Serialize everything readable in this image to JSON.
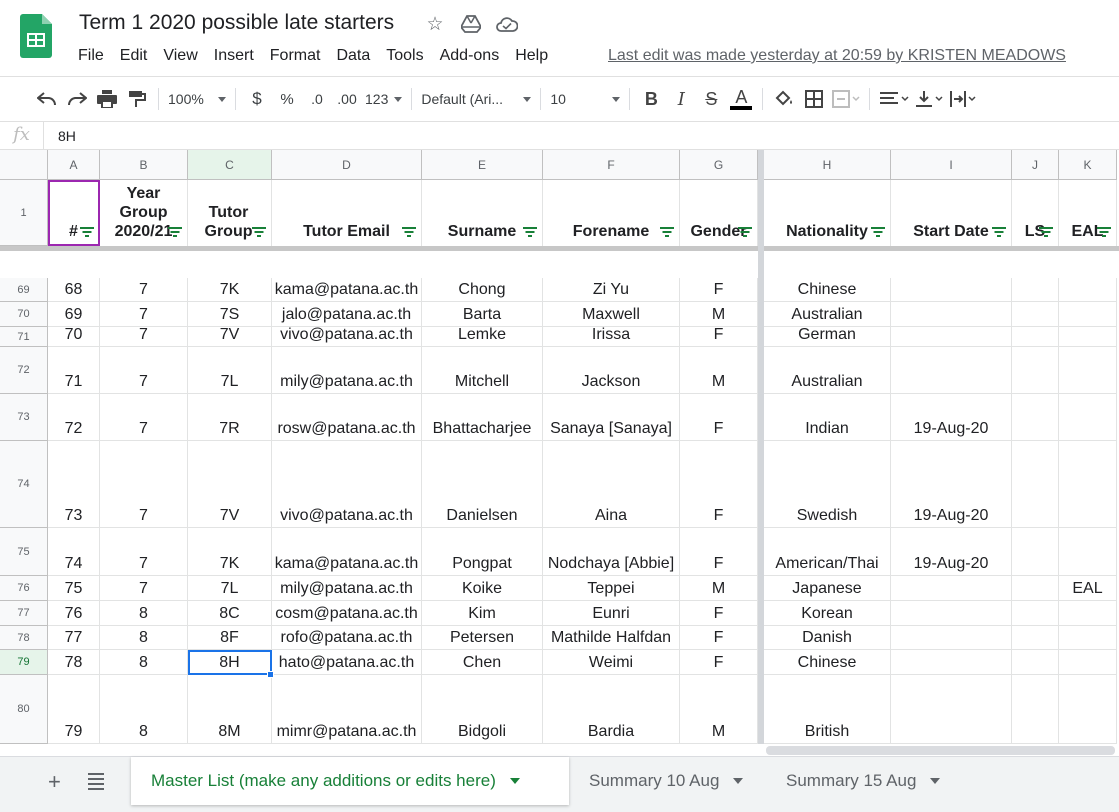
{
  "app": {
    "title": "Term 1 2020 possible late starters",
    "menu": [
      "File",
      "Edit",
      "View",
      "Insert",
      "Format",
      "Data",
      "Tools",
      "Add-ons",
      "Help"
    ],
    "last_edit": "Last edit was made yesterday at 20:59 by KRISTEN MEADOWS"
  },
  "toolbar": {
    "zoom": "100%",
    "currency": "$",
    "percent": "%",
    "decrease_decimal": ".0",
    "increase_decimal": ".00",
    "more_formats": "123",
    "font": "Default (Ari...",
    "font_size": "10",
    "bold": "B",
    "italic": "I",
    "strike": "S",
    "text_color": "A",
    "text_color_hex": "#000000"
  },
  "formula_bar": {
    "fx": "fx",
    "value": "8H"
  },
  "grid": {
    "columns": [
      "A",
      "B",
      "C",
      "D",
      "E",
      "F",
      "G",
      "H",
      "I",
      "J",
      "K"
    ],
    "header_row_number": "1",
    "headers": [
      "#",
      "Year\nGroup\n2020/21",
      "Tutor Group",
      "Tutor Email",
      "Surname",
      "Forename",
      "Gender",
      "Nationality",
      "Start Date",
      "LS",
      "EAL"
    ],
    "rows": [
      {
        "n": "69",
        "cells": [
          "68",
          "7",
          "7K",
          "kama@patana.ac.th",
          "Chong",
          "Zi Yu",
          "F",
          "Chinese",
          "",
          "",
          ""
        ]
      },
      {
        "n": "70",
        "cells": [
          "69",
          "7",
          "7S",
          "jalo@patana.ac.th",
          "Barta",
          "Maxwell",
          "M",
          "Australian",
          "",
          "",
          ""
        ]
      },
      {
        "n": "71",
        "cells": [
          "70",
          "7",
          "7V",
          "vivo@patana.ac.th",
          "Lemke",
          "Irissa",
          "F",
          "German",
          "",
          "",
          ""
        ]
      },
      {
        "n": "72",
        "cells": [
          "71",
          "7",
          "7L",
          "mily@patana.ac.th",
          "Mitchell",
          "Jackson",
          "M",
          "Australian",
          "",
          "",
          ""
        ]
      },
      {
        "n": "73",
        "cells": [
          "72",
          "7",
          "7R",
          "rosw@patana.ac.th",
          "Bhattacharjee",
          "Sanaya [Sanaya]",
          "F",
          "Indian",
          "19-Aug-20",
          "",
          ""
        ]
      },
      {
        "n": "74",
        "cells": [
          "73",
          "7",
          "7V",
          "vivo@patana.ac.th",
          "Danielsen",
          "Aina",
          "F",
          "Swedish",
          "19-Aug-20",
          "",
          ""
        ]
      },
      {
        "n": "75",
        "cells": [
          "74",
          "7",
          "7K",
          "kama@patana.ac.th",
          "Pongpat",
          "Nodchaya [Abbie]",
          "F",
          "American/Thai",
          "19-Aug-20",
          "",
          ""
        ]
      },
      {
        "n": "76",
        "cells": [
          "75",
          "7",
          "7L",
          "mily@patana.ac.th",
          "Koike",
          "Teppei",
          "M",
          "Japanese",
          "",
          "",
          "EAL"
        ]
      },
      {
        "n": "77",
        "cells": [
          "76",
          "8",
          "8C",
          "cosm@patana.ac.th",
          "Kim",
          "Eunri",
          "F",
          "Korean",
          "",
          "",
          ""
        ]
      },
      {
        "n": "78",
        "cells": [
          "77",
          "8",
          "8F",
          "rofo@patana.ac.th",
          "Petersen",
          "Mathilde Halfdan",
          "F",
          "Danish",
          "",
          "",
          ""
        ]
      },
      {
        "n": "79",
        "cells": [
          "78",
          "8",
          "8H",
          "hato@patana.ac.th",
          "Chen",
          "Weimi",
          "F",
          "Chinese",
          "",
          "",
          ""
        ]
      },
      {
        "n": "80",
        "cells": [
          "79",
          "8",
          "8M",
          "mimr@patana.ac.th",
          "Bidgoli",
          "Bardia",
          "M",
          "British",
          "",
          "",
          ""
        ]
      }
    ]
  },
  "sheets": {
    "add": "+",
    "tabs": [
      "Master List (make any additions or edits here)",
      "Summary 10 Aug",
      "Summary 15 Aug"
    ],
    "active_index": 0
  },
  "colors": {
    "accent": "#188038",
    "selection": "#1a73e8"
  }
}
